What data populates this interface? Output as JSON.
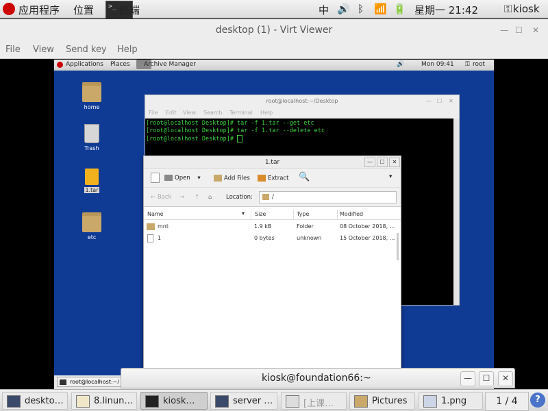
{
  "host_topbar": {
    "applications": "应用程序",
    "places": "位置",
    "active_app": "终端",
    "input_method": "中",
    "clock": "星期一 21:42",
    "user": "kiosk"
  },
  "virt_viewer": {
    "title": "desktop (1) - Virt Viewer",
    "menu": [
      "File",
      "View",
      "Send key",
      "Help"
    ]
  },
  "guest_topbar": {
    "applications": "Applications",
    "places": "Places",
    "app_name": "Archive Manager",
    "clock": "Mon 09:41",
    "user": "root"
  },
  "desktop_icons": [
    {
      "label": "home"
    },
    {
      "label": "Trash"
    },
    {
      "label": "1.tar"
    },
    {
      "label": "etc"
    }
  ],
  "terminal": {
    "title": "root@localhost:~/Desktop",
    "menu": [
      "File",
      "Edit",
      "View",
      "Search",
      "Terminal",
      "Help"
    ],
    "lines": [
      "[root@localhost Desktop]# tar -f 1.tar --get etc",
      "[root@localhost Desktop]# tar -f 1.tar --delete etc",
      "[root@localhost Desktop]# "
    ]
  },
  "archive": {
    "title": "1.tar",
    "toolbar": {
      "open": "Open",
      "add_files": "Add Files",
      "extract": "Extract"
    },
    "nav": {
      "back": "Back",
      "location_label": "Location:",
      "location_value": "/"
    },
    "columns": [
      "Name",
      "Size",
      "Type",
      "Modified"
    ],
    "files": [
      {
        "name": "mnt",
        "size": "1.9 kB",
        "type": "Folder",
        "modified": "08 October 2018, ..."
      },
      {
        "name": "1",
        "size": "0 bytes",
        "type": "unknown",
        "modified": "15 October 2018, ..."
      }
    ]
  },
  "guest_taskbar": {
    "item": "root@localhost:~/"
  },
  "kiosk_terminal": {
    "title": "kiosk@foundation66:~"
  },
  "host_taskbar": {
    "tasks": [
      "deskto…",
      "8.linun…",
      "kiosk…",
      "server …",
      "[上课…",
      "Pictures",
      "1.png"
    ],
    "workspace": "1 / 4"
  },
  "colors": {
    "guest_desktop": "#0f3b95",
    "terminal_green": "#3fd33f",
    "folder": "#c9a86a"
  }
}
